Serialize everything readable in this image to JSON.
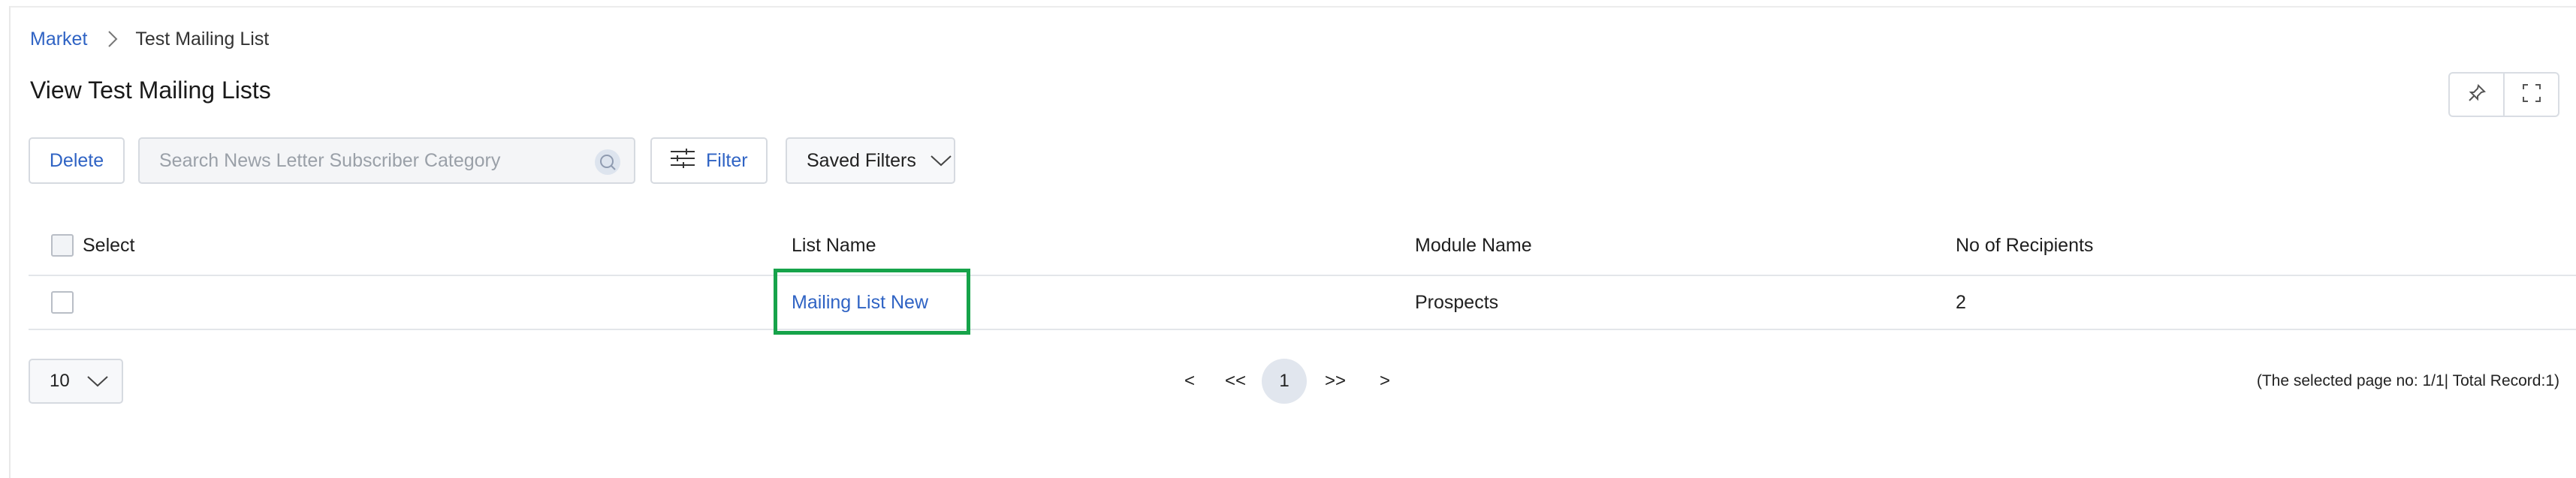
{
  "breadcrumb": {
    "root": "Market",
    "current": "Test Mailing List"
  },
  "page": {
    "title": "View Test Mailing Lists"
  },
  "toolbar": {
    "delete_label": "Delete",
    "search_placeholder": "Search News Letter Subscriber Category",
    "filter_label": "Filter",
    "saved_filters_label": "Saved Filters"
  },
  "table": {
    "headers": [
      "Select",
      "List Name",
      "Module Name",
      "No of Recipients"
    ],
    "rows": [
      {
        "list_name": "Mailing List New",
        "module_name": "Prospects",
        "recipients": "2"
      }
    ]
  },
  "pagination": {
    "page_size": "10",
    "prev": "<",
    "first": "<<",
    "current": "1",
    "last": ">>",
    "next": ">",
    "summary": "(The selected page no: 1/1| Total Record:1)"
  },
  "colors": {
    "accent": "#2f63c4",
    "highlight": "#16a34a"
  }
}
